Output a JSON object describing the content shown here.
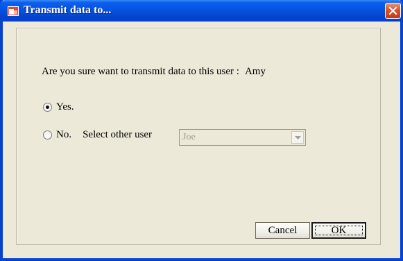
{
  "window": {
    "title": "Transmit data to...",
    "icons": {
      "app": "app-window-icon",
      "close": "close-icon"
    }
  },
  "dialog": {
    "question": "Are you sure want to transmit data to this user :",
    "target_user": "Amy",
    "options": {
      "yes_label": "Yes.",
      "yes_checked": true,
      "no_label": "No.",
      "no_checked": false
    },
    "select_other_label": "Select other user",
    "select": {
      "value": "Joe",
      "enabled": false
    },
    "buttons": {
      "cancel": "Cancel",
      "ok": "OK"
    }
  },
  "colors": {
    "titlebar": "#0553e0",
    "close": "#d9522c",
    "face": "#ece9d8"
  }
}
